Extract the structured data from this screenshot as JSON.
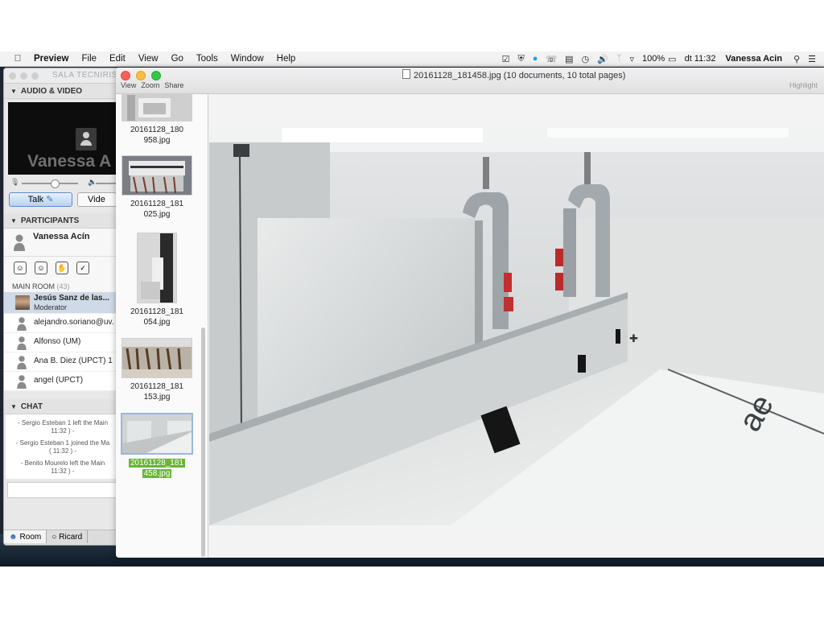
{
  "menubar": {
    "app_name": "Preview",
    "menus": [
      "File",
      "Edit",
      "View",
      "Go",
      "Tools",
      "Window",
      "Help"
    ],
    "battery": "100%",
    "clock": "dt 11:32",
    "user": "Vanessa Acin"
  },
  "conference": {
    "window_title": "SALA TECNIRIS",
    "audio_video_header": "AUDIO & VIDEO",
    "video_name": "Vanessa A",
    "talk_label": "Talk",
    "video_label": "Vide",
    "participants_header": "PARTICIPANTS",
    "me_name": "Vanessa Acín",
    "room_label": "MAIN ROOM",
    "room_count": "(43)",
    "moderator": {
      "name": "Jesús Sanz de las...",
      "role": "Moderator"
    },
    "participants": [
      "alejandro.soriano@uv.",
      "Alfonso (UM)",
      "Ana B. Diez (UPCT) 1",
      "angel (UPCT)"
    ],
    "chat_header": "CHAT",
    "chat_lines": [
      [
        "- Sergio Esteban 1 left the Main",
        "11:32 ) -"
      ],
      [
        "- Sergio Esteban 1 joined the Ma",
        "( 11:32 ) -"
      ],
      [
        "- Benito Mourelo left the Main",
        "11:32 ) -"
      ]
    ],
    "tabs": [
      "Room",
      "Ricard"
    ]
  },
  "preview": {
    "title": "20161128_181458.jpg (10 documents, 10 total pages)",
    "toolbar": [
      "View",
      "Zoom",
      "Share"
    ],
    "highlight_label": "Highlight",
    "thumbnails": [
      {
        "line1": "20161128_180",
        "line2": "958.jpg"
      },
      {
        "line1": "20161128_181",
        "line2": "025.jpg"
      },
      {
        "line1": "20161128_181",
        "line2": "054.jpg"
      },
      {
        "line1": "20161128_181",
        "line2": "153.jpg"
      },
      {
        "line1": "20161128_181",
        "line2": "458.jpg"
      }
    ]
  }
}
